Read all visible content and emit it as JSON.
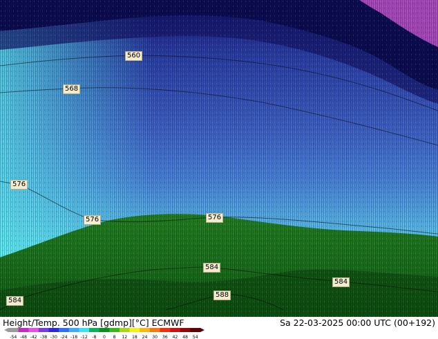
{
  "map": {
    "contour_labels": [
      {
        "text": "560"
      },
      {
        "text": "568"
      },
      {
        "text": "576"
      },
      {
        "text": "576"
      },
      {
        "text": "576"
      },
      {
        "text": "584"
      },
      {
        "text": "584"
      },
      {
        "text": "584"
      },
      {
        "text": "588"
      }
    ],
    "colors": {
      "deep_navy": "#0b0c52",
      "blue": "#3f63c8",
      "light_blue": "#5aa3e6",
      "cyan": "#55d9ec",
      "green": "#1f7a1f",
      "dark_green": "#0d4a10",
      "magenta": "#d060d8"
    }
  },
  "footer": {
    "title": "Height/Temp. 500 hPa [gdmp][°C] ECMWF",
    "datetime": "Sa 22-03-2025 00:00 UTC (00+192)",
    "colorbar": {
      "ticks": [
        "-54",
        "-48",
        "-42",
        "-38",
        "-30",
        "-24",
        "-18",
        "-12",
        "-8",
        "0",
        "8",
        "12",
        "18",
        "24",
        "30",
        "36",
        "42",
        "48",
        "54"
      ],
      "colors": [
        "#9a9a9a",
        "#c02cc0",
        "#e64ee6",
        "#7a3cd8",
        "#2b2bd0",
        "#2f6ff0",
        "#42a9f6",
        "#3ce3ee",
        "#0fae5a",
        "#0b8e1e",
        "#36b81e",
        "#a8d41a",
        "#f2f21a",
        "#f7b814",
        "#f27a12",
        "#e83212",
        "#c81414",
        "#8c0c0c",
        "#5a0505"
      ]
    }
  }
}
